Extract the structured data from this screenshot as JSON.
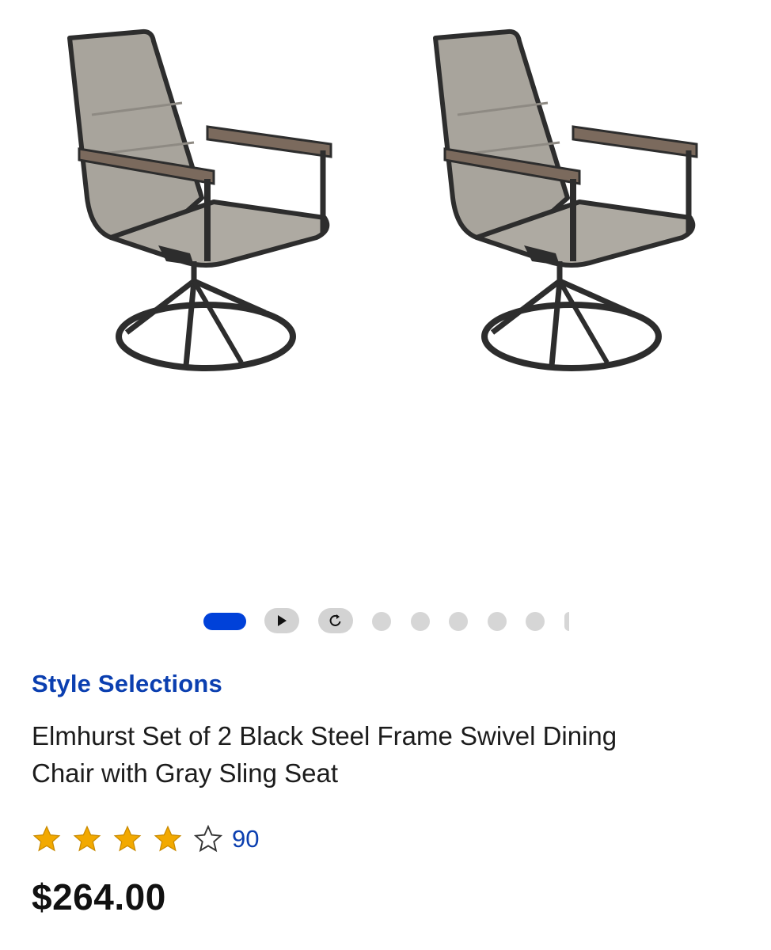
{
  "product": {
    "brand": "Style Selections",
    "title_line1": "Elmhurst Set of 2 Black Steel Frame Swivel Dining",
    "title_line2": "Chair with Gray Sling Seat",
    "rating": 3.5,
    "rating_max": 5,
    "review_count": "90",
    "price": "$264.00"
  },
  "gallery": {
    "active_index": 0,
    "media_icons": [
      "play-icon",
      "spin-360-icon"
    ],
    "image_dot_count": 5
  },
  "colors": {
    "accent": "#0041d9",
    "brand_link": "#0b3fb0",
    "star": "#f2a900",
    "inactive_dot": "#d6d6d6"
  }
}
